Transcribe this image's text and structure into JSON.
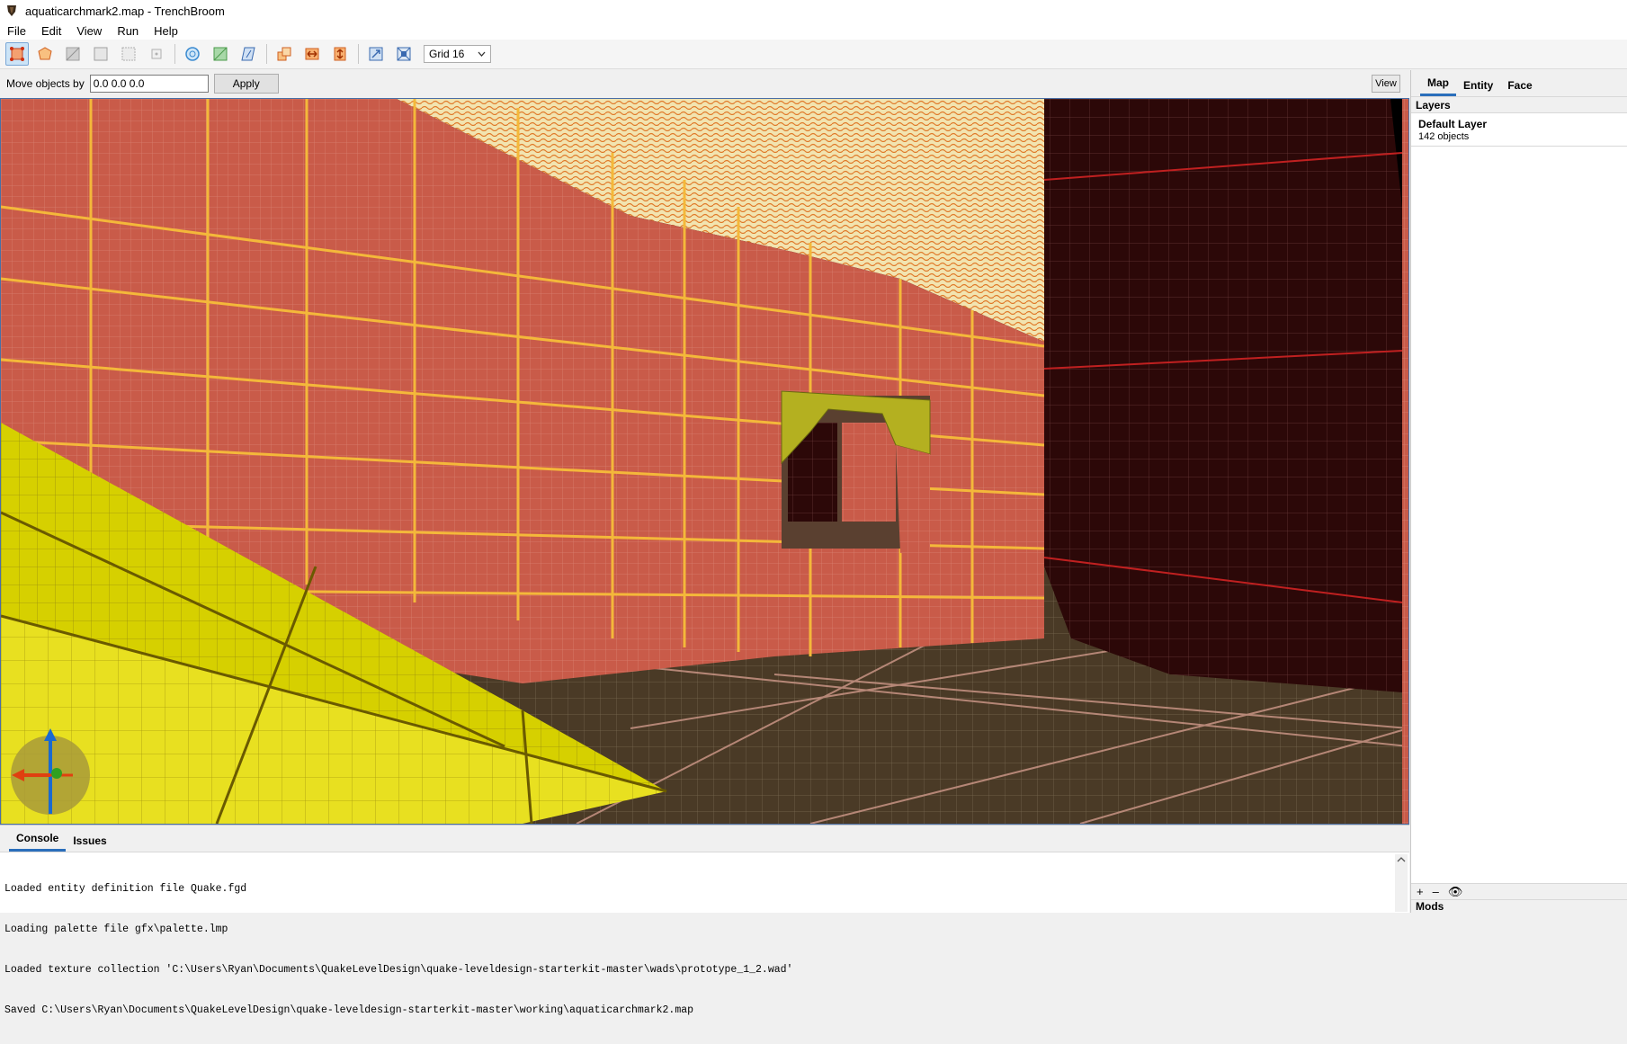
{
  "window": {
    "title": "aquaticarchmark2.map - TrenchBroom"
  },
  "menu": [
    "File",
    "Edit",
    "View",
    "Run",
    "Help"
  ],
  "toolbar": {
    "tools": [
      "move-tool-icon",
      "vertex-tool-icon",
      "edge-tool-icon",
      "face-tool-icon",
      "clip-tool-icon",
      "rotate-tool-icon",
      "scale-tool-icon",
      "shear-tool-icon",
      "duplicate-icon",
      "flip-horizontal-icon",
      "flip-vertical-icon",
      "texture-lock-icon",
      "uv-lock-icon"
    ],
    "grid_label": "Grid 16"
  },
  "move": {
    "label": "Move objects by",
    "value": "0.0 0.0 0.0",
    "apply_label": "Apply",
    "view_label": "View"
  },
  "side": {
    "tabs": [
      "Map",
      "Entity",
      "Face"
    ],
    "layers_header": "Layers",
    "layer_name": "Default Layer",
    "layer_count": "142 objects",
    "footer_icons": [
      "+",
      "–",
      "👁"
    ],
    "mods_label": "Mods"
  },
  "console": {
    "tabs": [
      "Console",
      "Issues"
    ],
    "lines": [
      "Loaded entity definition file Quake.fgd",
      "Loading palette file gfx\\palette.lmp",
      "Loaded texture collection 'C:\\Users\\Ryan\\Documents\\QuakeLevelDesign\\quake-leveldesign-starterkit-master\\wads\\prototype_1_2.wad'",
      "Saved C:\\Users\\Ryan\\Documents\\QuakeLevelDesign\\quake-leveldesign-starterkit-master\\working\\aquaticarchmark2.map"
    ]
  },
  "colors": {
    "accent": "#2a6ebb",
    "wall": "#c95b49",
    "wall_line": "#f0b030",
    "floor": "#4a3a26",
    "pillar": "#2c0808",
    "brush": "#e8e020"
  }
}
